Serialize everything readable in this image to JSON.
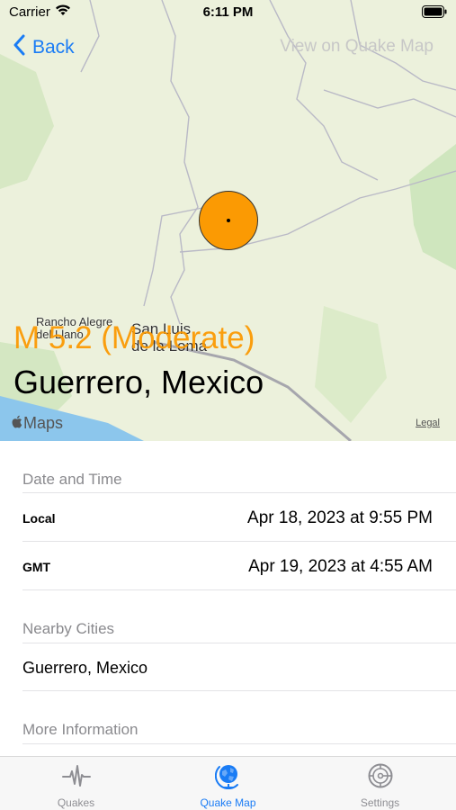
{
  "status_bar": {
    "carrier": "Carrier",
    "time": "6:11 PM"
  },
  "nav": {
    "back_label": "Back",
    "right_label": "View on Quake Map"
  },
  "map": {
    "labels": {
      "rancho_alegre_line1": "Rancho Alegre",
      "rancho_alegre_line2": "del Llano",
      "san_luis_line1": "San Luis",
      "san_luis_line2": "de la Loma"
    },
    "maps_logo": "Maps",
    "legal": "Legal",
    "marker_color": "#fb9a03"
  },
  "quake": {
    "magnitude_text": "M 5.2 (Moderate)",
    "location": "Guerrero, Mexico"
  },
  "details": {
    "date_time_header": "Date and Time",
    "local_label": "Local",
    "local_value": "Apr 18, 2023 at 9:55 PM",
    "gmt_label": "GMT",
    "gmt_value": "Apr 19, 2023 at 4:55 AM",
    "nearby_header": "Nearby Cities",
    "nearby_city": "Guerrero, Mexico",
    "more_info_header": "More Information"
  },
  "tabbar": {
    "tabs": [
      {
        "label": "Quakes",
        "icon": "waveform-icon",
        "active": false
      },
      {
        "label": "Quake Map",
        "icon": "globe-icon",
        "active": true
      },
      {
        "label": "Settings",
        "icon": "gear-icon",
        "active": false
      }
    ]
  },
  "colors": {
    "accent": "#1a7cf5",
    "magnitude": "#fb9a03",
    "map_land": "#ecf1dc",
    "water": "#8cc6ec"
  }
}
